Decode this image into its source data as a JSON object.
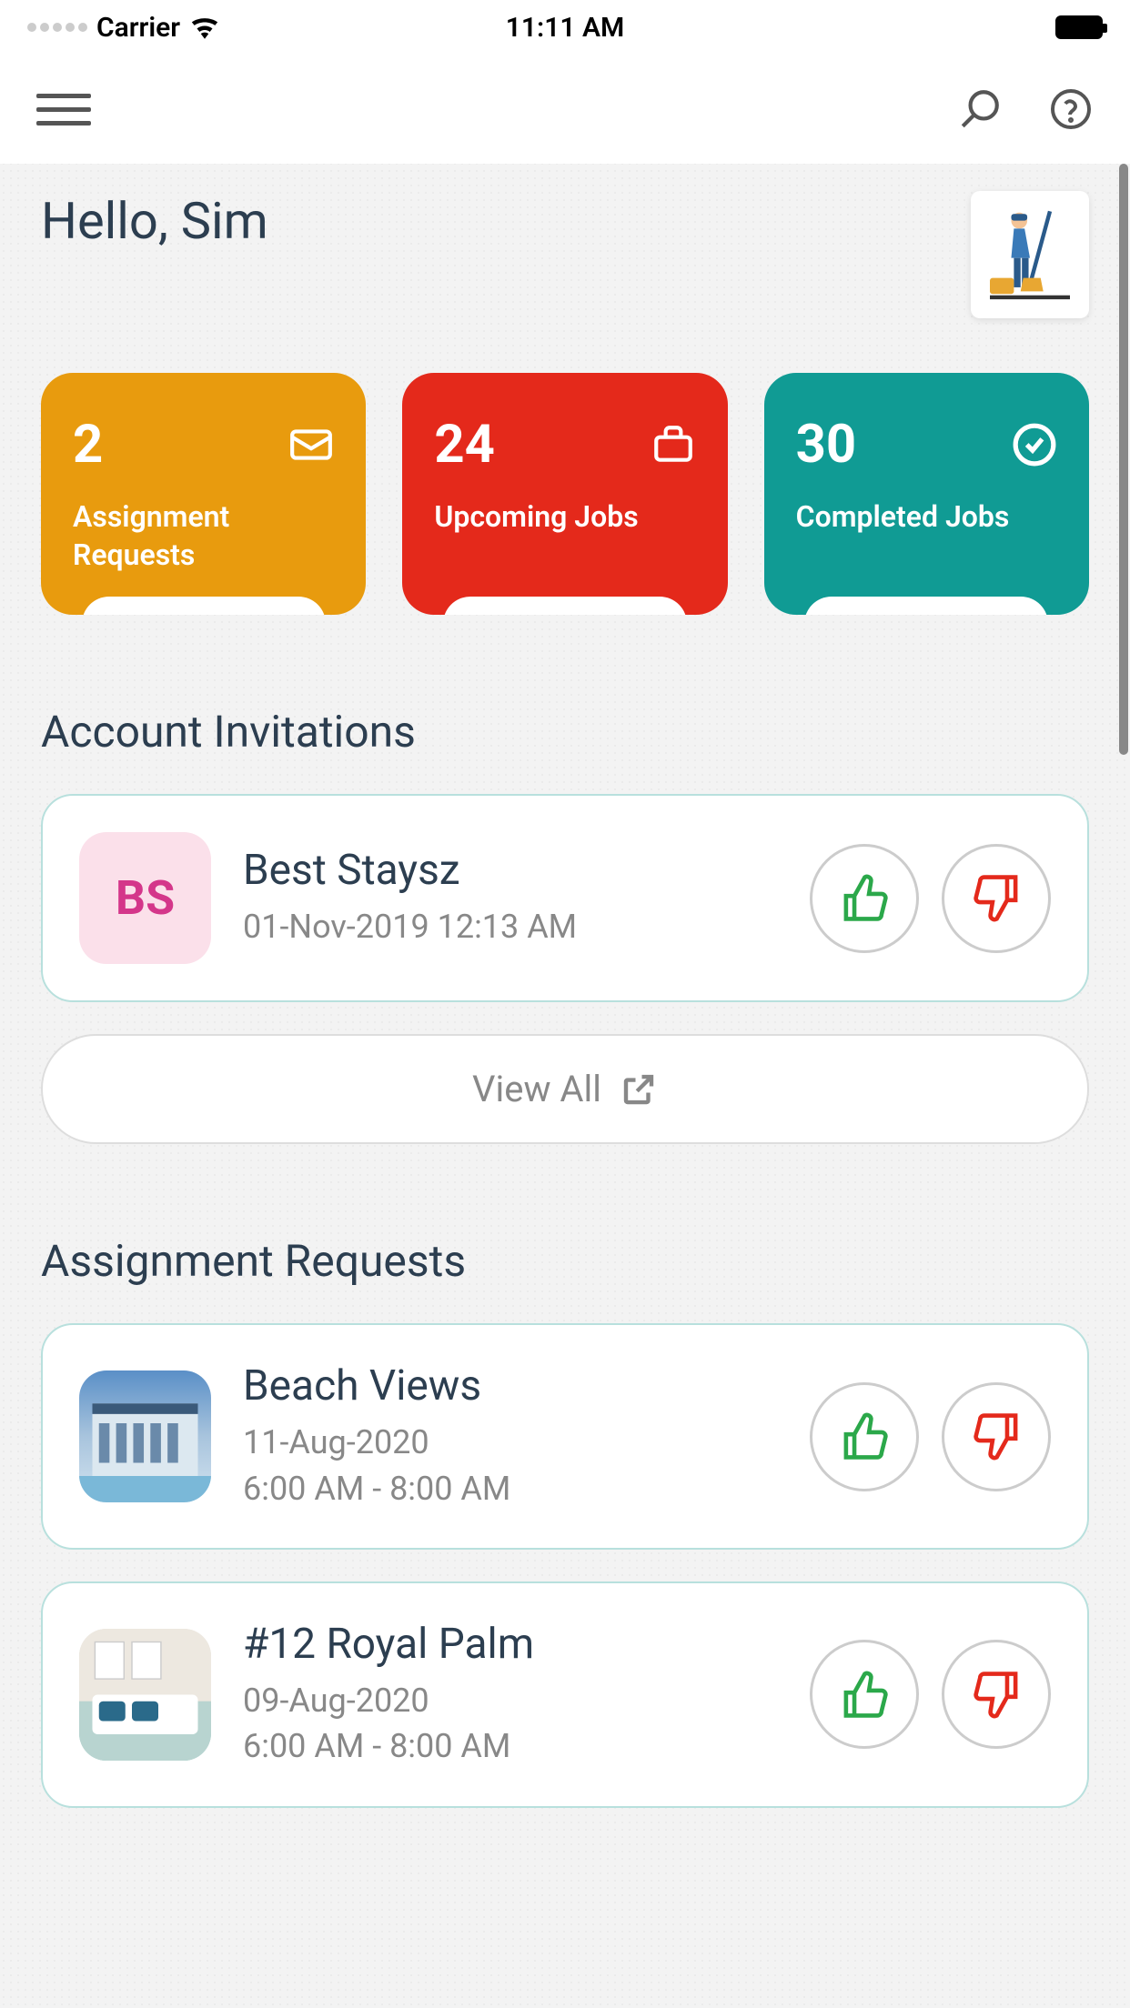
{
  "status_bar": {
    "carrier": "Carrier",
    "time": "11:11 AM"
  },
  "greeting": "Hello, Sim",
  "stats": [
    {
      "count": "2",
      "label": "Assignment Requests",
      "color": "orange",
      "icon": "envelope"
    },
    {
      "count": "24",
      "label": "Upcoming Jobs",
      "color": "red",
      "icon": "briefcase"
    },
    {
      "count": "30",
      "label": "Completed Jobs",
      "color": "teal",
      "icon": "check-circle"
    }
  ],
  "invitations_title": "Account Invitations",
  "invitations": [
    {
      "initials": "BS",
      "name": "Best Staysz",
      "datetime": "01-Nov-2019 12:13 AM"
    }
  ],
  "view_all_label": "View All",
  "requests_title": "Assignment Requests",
  "requests": [
    {
      "name": "Beach Views",
      "date": "11-Aug-2020",
      "time": "6:00 AM - 8:00 AM",
      "img": "beach"
    },
    {
      "name": "#12 Royal Palm",
      "date": "09-Aug-2020",
      "time": "6:00 AM - 8:00 AM",
      "img": "room"
    }
  ]
}
